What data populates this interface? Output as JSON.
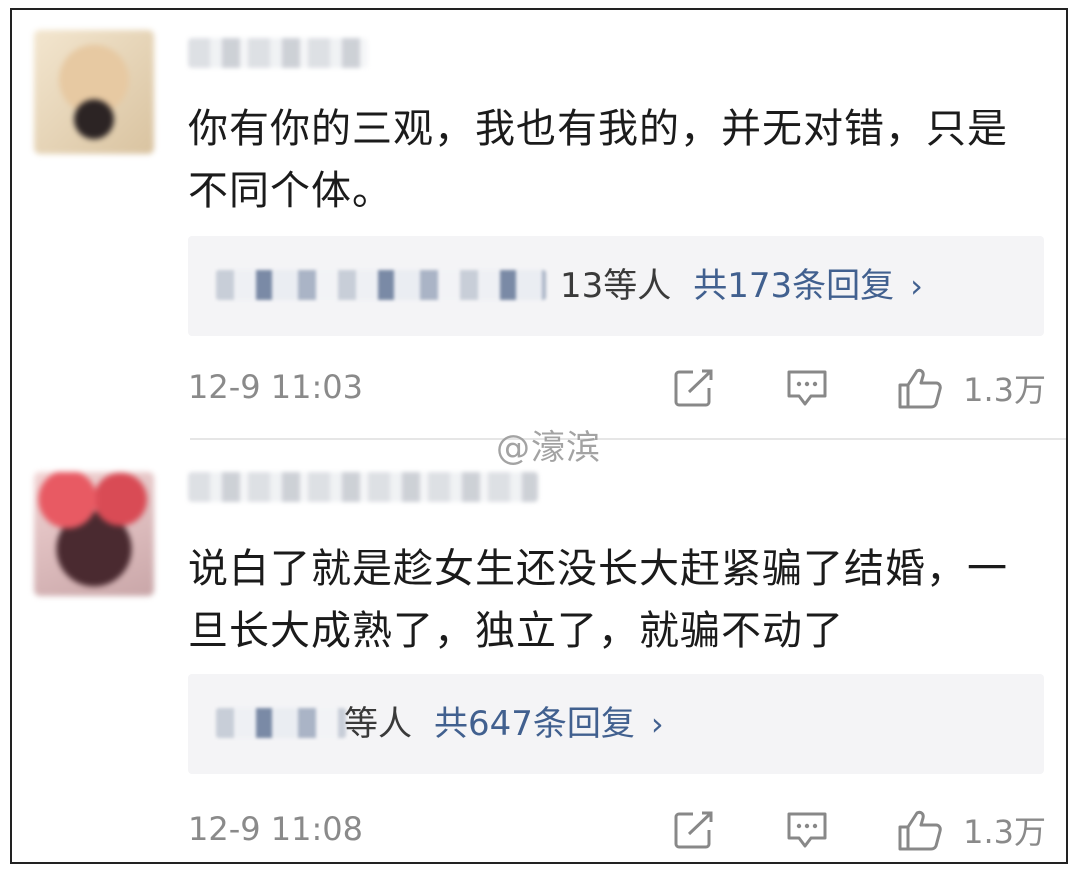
{
  "comments": [
    {
      "text": "你有你的三观，我也有我的，并无对错，只是不同个体。",
      "reply_names": "13等人",
      "reply_count": "共173条回复",
      "chevron": "›",
      "time": "12-9 11:03",
      "likes": "1.3万"
    },
    {
      "text": "说白了就是趁女生还没长大赶紧骗了结婚，一旦长大成熟了，独立了，就骗不动了",
      "reply_names": "等人",
      "reply_count": "共647条回复",
      "chevron": "›",
      "time": "12-9 11:08",
      "likes": "1.3万"
    }
  ],
  "watermark": "@濠滨",
  "icons": {
    "share": "share-icon",
    "comment": "comment-icon",
    "like": "thumbs-up-icon"
  },
  "colors": {
    "link": "#41608f",
    "meta": "#8a8a8a",
    "reply_bg": "#f4f4f6"
  }
}
